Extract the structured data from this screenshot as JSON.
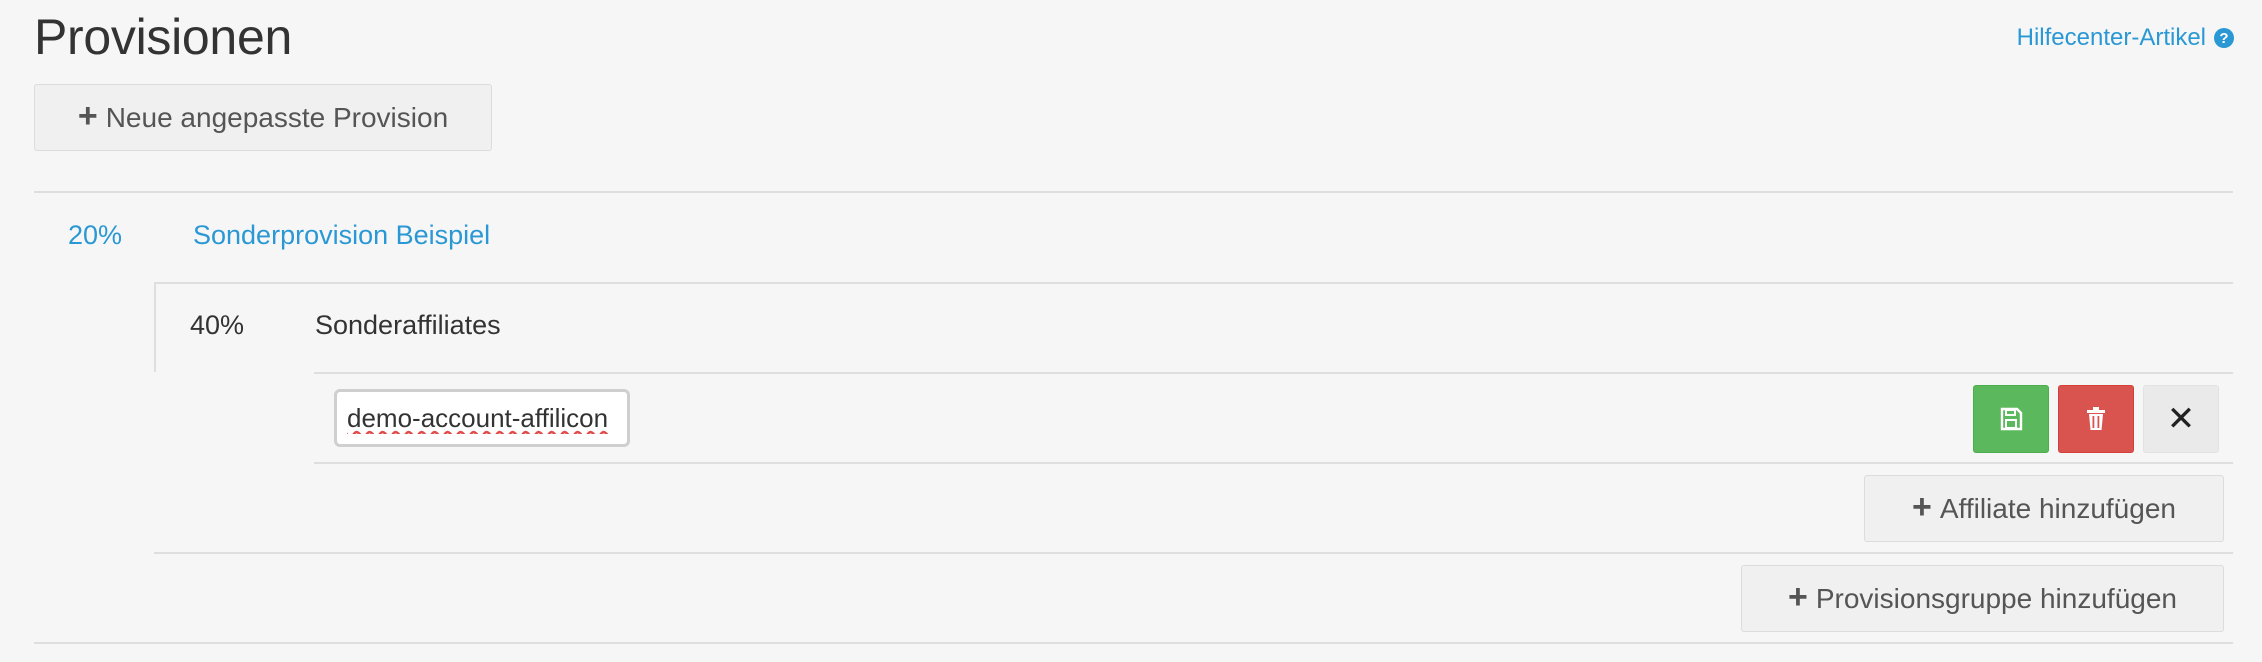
{
  "page": {
    "title": "Provisionen",
    "help_link": "Hilfecenter-Artikel",
    "help_icon": "question-circle-icon"
  },
  "toolbar": {
    "new_commission_label": "Neue angepasste Provision"
  },
  "commission": {
    "percent": "20%",
    "name": "Sonderprovision Beispiel",
    "group": {
      "percent": "40%",
      "name": "Sonderaffiliates",
      "affiliate_input_value": "demo-account-affilicon",
      "actions": {
        "save_icon": "save-icon",
        "delete_icon": "trash-icon",
        "cancel_icon": "close-icon"
      },
      "add_affiliate_label": "Affiliate hinzufügen"
    },
    "add_group_label": "Provisionsgruppe hinzufügen"
  },
  "colors": {
    "accent": "#2a98d4",
    "save": "#5cb85c",
    "delete": "#d9534f",
    "background": "#f6f6f6"
  }
}
